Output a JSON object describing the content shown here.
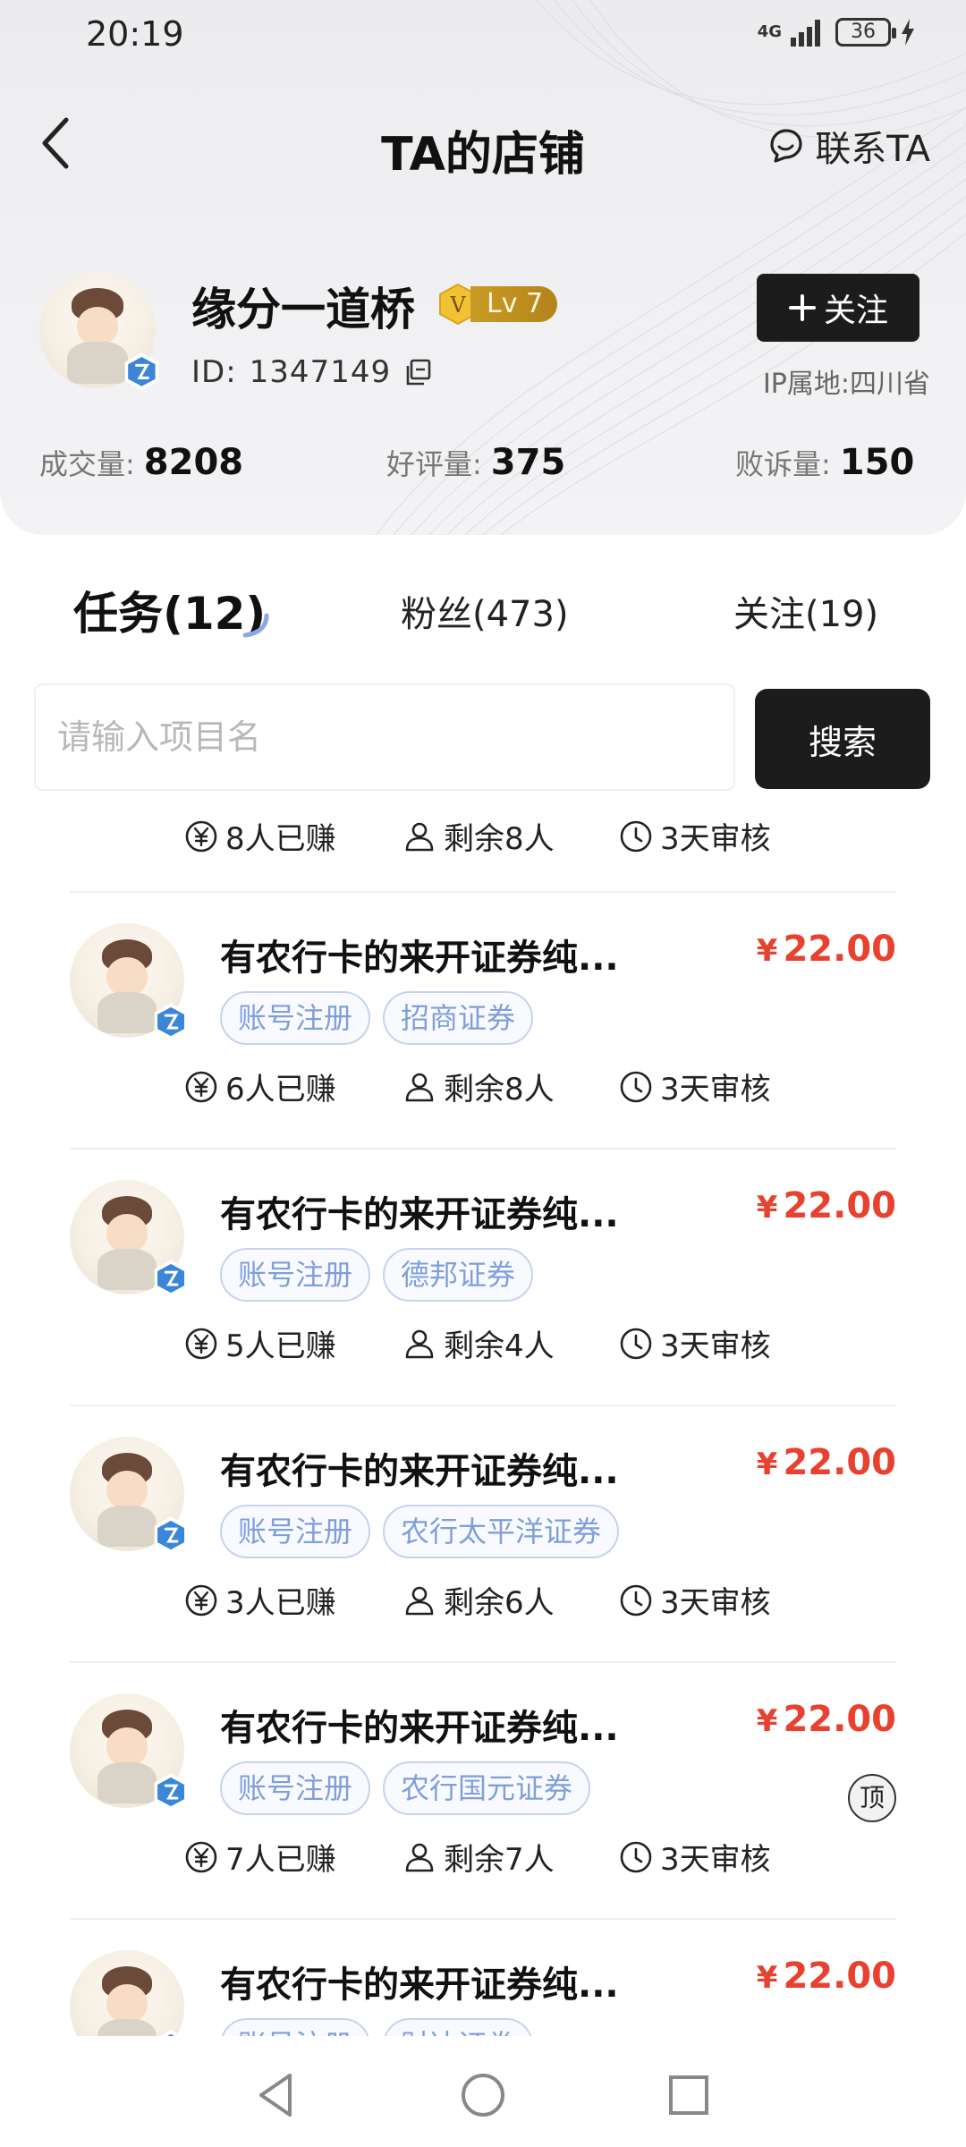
{
  "status_bar": {
    "time": "20:19",
    "network": "4G",
    "battery": "36"
  },
  "nav": {
    "title": "TA的店铺",
    "contact_label": "联系TA"
  },
  "profile": {
    "name": "缘分一道桥",
    "vip_level": "Lv 7",
    "vip_letter": "V",
    "id_label": "ID:",
    "id_value": "1347149",
    "follow_label": "关注",
    "ip_location": "IP属地:四川省"
  },
  "stats": [
    {
      "label": "成交量:",
      "value": "8208"
    },
    {
      "label": "好评量:",
      "value": "375"
    },
    {
      "label": "败诉量:",
      "value": "150"
    }
  ],
  "tabs": [
    {
      "label": "任务(12)",
      "active": true
    },
    {
      "label": "粉丝(473)",
      "active": false
    },
    {
      "label": "关注(19)",
      "active": false
    }
  ],
  "search": {
    "placeholder": "请输入项目名",
    "button_label": "搜索"
  },
  "partial_top_meta": {
    "earned": "8人已赚",
    "remaining": "剩余8人",
    "review": "3天审核"
  },
  "tasks": [
    {
      "title": "有农行卡的来开证券纯...",
      "price": "22.00",
      "currency": "¥",
      "tags": [
        "账号注册",
        "招商证券"
      ],
      "earned": "6人已赚",
      "remaining": "剩余8人",
      "review": "3天审核",
      "pinned": false
    },
    {
      "title": "有农行卡的来开证券纯...",
      "price": "22.00",
      "currency": "¥",
      "tags": [
        "账号注册",
        "德邦证券"
      ],
      "earned": "5人已赚",
      "remaining": "剩余4人",
      "review": "3天审核",
      "pinned": false
    },
    {
      "title": "有农行卡的来开证券纯...",
      "price": "22.00",
      "currency": "¥",
      "tags": [
        "账号注册",
        "农行太平洋证券"
      ],
      "earned": "3人已赚",
      "remaining": "剩余6人",
      "review": "3天审核",
      "pinned": false
    },
    {
      "title": "有农行卡的来开证券纯...",
      "price": "22.00",
      "currency": "¥",
      "tags": [
        "账号注册",
        "农行国元证券"
      ],
      "earned": "7人已赚",
      "remaining": "剩余7人",
      "review": "3天审核",
      "pinned": true,
      "pinned_label": "顶"
    },
    {
      "title": "有农行卡的来开证券纯...",
      "price": "22.00",
      "currency": "¥",
      "tags": [
        "账号注册",
        "财达证券"
      ],
      "earned": "",
      "remaining": "",
      "review": "",
      "pinned": false
    }
  ],
  "colors": {
    "price_red": "#e8412f",
    "tag_blue": "#7f9fd9",
    "tag_border": "#c6d3ee",
    "dark_button": "#1c1c1c",
    "vip_gold": "#c99b24"
  }
}
